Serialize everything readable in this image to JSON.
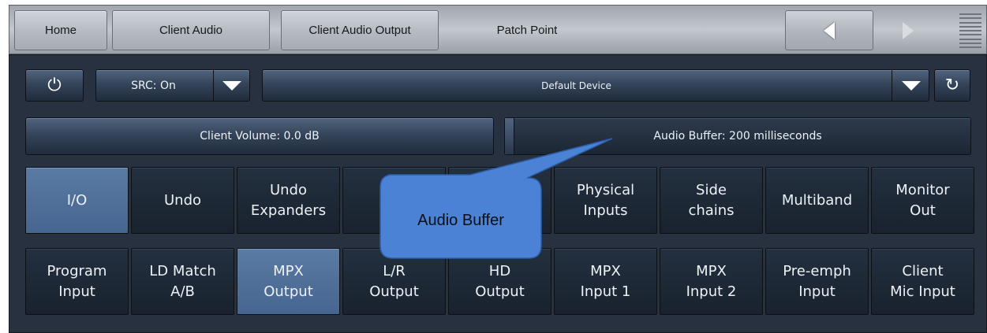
{
  "nav": {
    "home": "Home",
    "client_audio": "Client Audio",
    "client_audio_output": "Client Audio Output",
    "patch_point": "Patch Point"
  },
  "controls": {
    "src": "SRC: On",
    "device": "Default Device",
    "client_volume": "Client Volume: 0.0 dB",
    "audio_buffer": "Audio Buffer: 200 milliseconds"
  },
  "grid": {
    "row1": [
      "I/O",
      "Undo",
      "Undo\nExpanders",
      "",
      "",
      "Physical\nInputs",
      "Side\nchains",
      "Multiband",
      "Monitor\nOut"
    ],
    "row2": [
      "Program\nInput",
      "LD Match\nA/B",
      "MPX\nOutput",
      "L/R\nOutput",
      "HD\nOutput",
      "MPX\nInput 1",
      "MPX\nInput 2",
      "Pre-emph\nInput",
      "Client\nMic Input"
    ]
  },
  "callout": {
    "text": "Audio Buffer"
  },
  "colors": {
    "selected": "#4f6f98",
    "panel": "#273140",
    "callout": "#4b82d6"
  }
}
